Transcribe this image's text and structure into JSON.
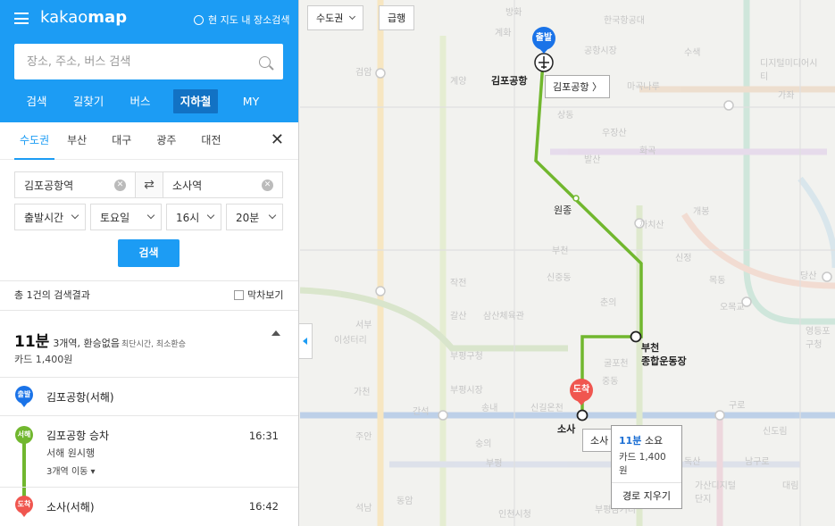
{
  "header": {
    "logo_light": "kakao",
    "logo_bold": "map",
    "in_map_search": "현 지도 내 장소검색",
    "search_placeholder": "장소, 주소, 버스 검색",
    "nav": [
      "검색",
      "길찾기",
      "버스",
      "지하철",
      "MY"
    ]
  },
  "region_tabs": [
    "수도권",
    "부산",
    "대구",
    "광주",
    "대전"
  ],
  "route_form": {
    "from": "김포공항역",
    "to": "소사역",
    "time_type": "출발시간",
    "day": "토요일",
    "hour": "16시",
    "minute": "20분",
    "search_button": "검색"
  },
  "results": {
    "count_text": "총 1건의 검색결과",
    "last_train": "막차보기",
    "duration": "11분",
    "summary": "3개역, 환승없음",
    "tags": "최단시간, 최소환승",
    "fare": "카드 1,400원"
  },
  "steps": {
    "start_pin": "출발",
    "start_name": "김포공항(서해)",
    "line_badge": "서해",
    "board": "김포공항 승차",
    "board_time": "16:31",
    "direction": "서해 원시행",
    "stops": "3개역 이동",
    "end_pin": "도착",
    "end_name": "소사(서해)",
    "end_time": "16:42"
  },
  "map": {
    "region_select": "수도권",
    "express_btn": "급행",
    "start_pin": "출발",
    "end_pin": "도착",
    "start_label": "김포공항",
    "start_tip": "김포공항",
    "mid_label": "원종",
    "bucheon_label_1": "부천",
    "bucheon_label_2": "종합운동장",
    "end_label": "소사",
    "end_tip": "소사",
    "popup_min": "11분",
    "popup_min_suffix": "소요",
    "popup_fare": "카드 1,400원",
    "popup_clear": "경로 지우기",
    "bg_labels": [
      "방화",
      "계화",
      "한국항공대",
      "수색",
      "디지털미디어시티",
      "가좌",
      "마곡나루",
      "검암",
      "계양",
      "공항시장",
      "발산",
      "우장산",
      "화곡",
      "까치산",
      "신정",
      "목동",
      "오목교",
      "당산",
      "영등포구청",
      "부평구청",
      "부천",
      "중동",
      "송내",
      "구로",
      "신도림",
      "대림",
      "가산디지털단지",
      "인천시청",
      "석남",
      "작전",
      "갈산",
      "신중동",
      "춘의",
      "굴포천",
      "삼산체육관",
      "부평시장",
      "이성터리",
      "신길온천",
      "숭의",
      "동암",
      "간석",
      "부평",
      "부평삼거리",
      "남구로",
      "독산",
      "가천",
      "상동",
      "서부",
      "주안",
      "개봉"
    ]
  },
  "colors": {
    "brand": "#1c9cf4",
    "nav_active": "#1272c4",
    "seohae_line": "#71b72e",
    "start_pin": "#1a73e8",
    "end_pin": "#f0564f"
  }
}
